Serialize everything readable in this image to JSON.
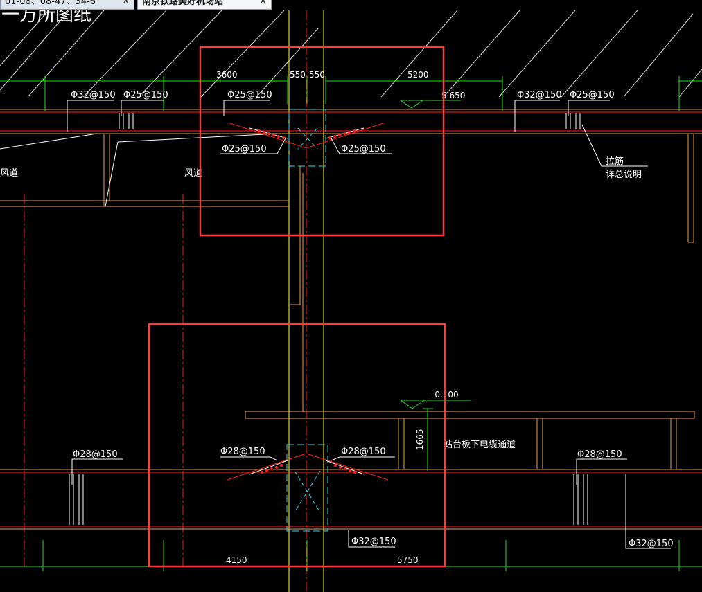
{
  "tabs": [
    {
      "title": "01-08、08-47、34-6",
      "active": false
    },
    {
      "title": "南京铁路美好机场站",
      "active": true
    }
  ],
  "drawing": {
    "corner_title": "一万所图纸",
    "top": {
      "dims": [
        "3600",
        "550",
        "550",
        "5200"
      ],
      "elevation": "5.650",
      "rebar_labels": [
        "Φ32@150",
        "Φ25@150",
        "Φ25@150",
        "Φ32@150",
        "Φ25@150"
      ],
      "haunch_left": "Φ25@150",
      "haunch_right": "Φ25@150",
      "duct_left": "风道",
      "duct_mid": "风道",
      "note_line1": "拉筋",
      "note_line2": "详总说明"
    },
    "bottom": {
      "elevation": "-0.100",
      "height": "1665",
      "channel_label": "站台板下电缆通道",
      "rebar_left": "Φ28@150",
      "rebar_right": "Φ28@150",
      "haunch_left": "Φ28@150",
      "haunch_right": "Φ28@150",
      "rebar_bottom": "Φ32@150",
      "rebar_bottom_right": "Φ32@150",
      "dims": [
        "4150",
        "5750"
      ]
    }
  },
  "colors": {
    "background": "#000000",
    "highlight_box": "#ff3b3b",
    "wall": "#e8a24a",
    "axis": "#ff2020",
    "column": "#33d9e8",
    "dimension": "#22dd22",
    "rebar": "#ffffff",
    "center_line": "#ffff44"
  }
}
